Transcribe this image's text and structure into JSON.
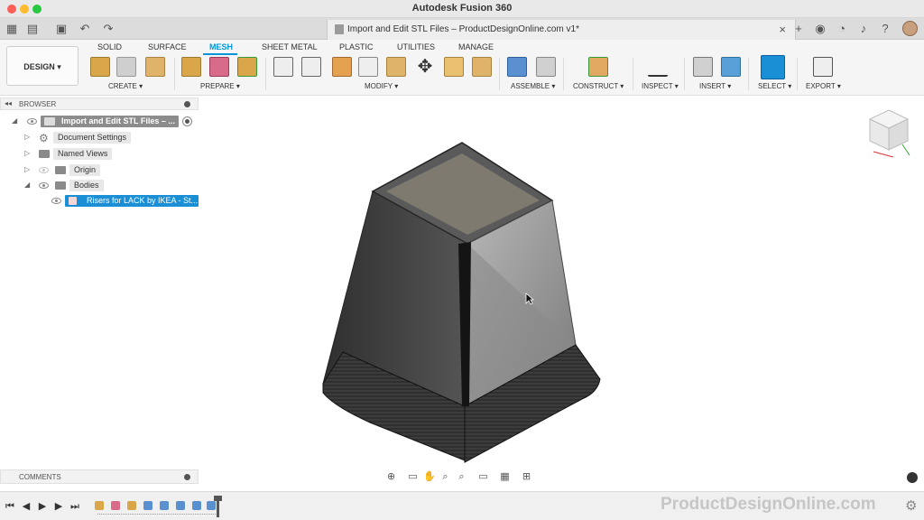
{
  "window": {
    "title": "Autodesk Fusion 360"
  },
  "document_tab": {
    "label": "Import and Edit STL Files – ProductDesignOnline.com v1*",
    "close_glyph": "×"
  },
  "design_button": {
    "label": "DESIGN ▾"
  },
  "workspace_tabs": [
    {
      "label": "SOLID",
      "active": false
    },
    {
      "label": "SURFACE",
      "active": false
    },
    {
      "label": "MESH",
      "active": true
    },
    {
      "label": "SHEET METAL",
      "active": false
    },
    {
      "label": "PLASTIC",
      "active": false
    },
    {
      "label": "UTILITIES",
      "active": false
    },
    {
      "label": "MANAGE",
      "active": false
    }
  ],
  "tool_groups": [
    {
      "label": "CREATE ▾"
    },
    {
      "label": "PREPARE ▾"
    },
    {
      "label": "MODIFY ▾"
    },
    {
      "label": "ASSEMBLE ▾"
    },
    {
      "label": "CONSTRUCT ▾"
    },
    {
      "label": "INSPECT ▾"
    },
    {
      "label": "INSERT ▾"
    },
    {
      "label": "SELECT ▾"
    },
    {
      "label": "EXPORT ▾"
    }
  ],
  "browser": {
    "title": "BROWSER",
    "root": "Import and Edit STL Files – ...",
    "items": [
      {
        "label": "Document Settings"
      },
      {
        "label": "Named Views"
      },
      {
        "label": "Origin"
      },
      {
        "label": "Bodies"
      },
      {
        "label": "Risers for LACK by IKEA - St..."
      }
    ]
  },
  "comments": {
    "title": "COMMENTS"
  },
  "watermark": {
    "text": "ProductDesignOnline.com"
  },
  "colors": {
    "accent": "#0696d7",
    "selection": "#1a8fd6",
    "model_dark": "#4a4a4a",
    "model_light": "#9a9a9a"
  }
}
